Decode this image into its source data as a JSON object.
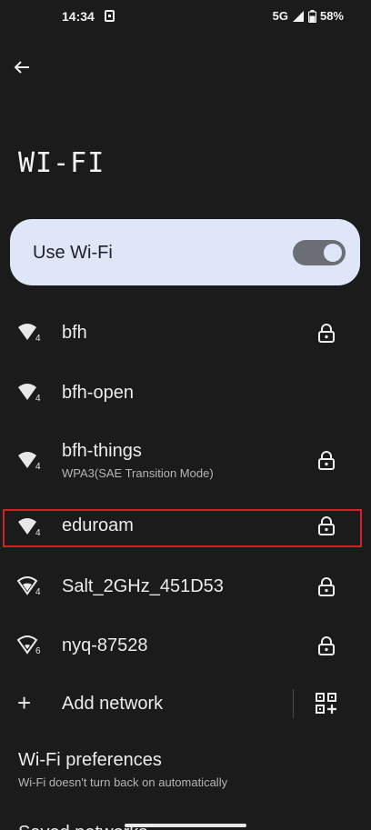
{
  "status_bar": {
    "time": "14:34",
    "network": "5G",
    "battery": "58%"
  },
  "title": "WI-FI",
  "use_wifi": {
    "label": "Use Wi-Fi",
    "enabled": true
  },
  "networks": [
    {
      "name": "bfh",
      "subtitle": "",
      "locked": true,
      "wifi_generation": "4"
    },
    {
      "name": "bfh-open",
      "subtitle": "",
      "locked": false,
      "wifi_generation": "4"
    },
    {
      "name": "bfh-things",
      "subtitle": "WPA3(SAE Transition Mode)",
      "locked": true,
      "wifi_generation": "4"
    },
    {
      "name": "eduroam",
      "subtitle": "",
      "locked": true,
      "wifi_generation": "4",
      "highlighted": true
    },
    {
      "name": "Salt_2GHz_451D53",
      "subtitle": "",
      "locked": true,
      "wifi_generation": "4"
    },
    {
      "name": "nyq-87528",
      "subtitle": "",
      "locked": true,
      "wifi_generation": "6"
    }
  ],
  "add_network": {
    "label": "Add network"
  },
  "preferences": {
    "title": "Wi-Fi preferences",
    "subtitle": "Wi-Fi doesn't turn back on automatically"
  },
  "peek_item": {
    "label": "Saved networks"
  },
  "colors": {
    "background": "#1b1b1b",
    "card": "#dfe6f8",
    "highlight": "#d42028"
  }
}
